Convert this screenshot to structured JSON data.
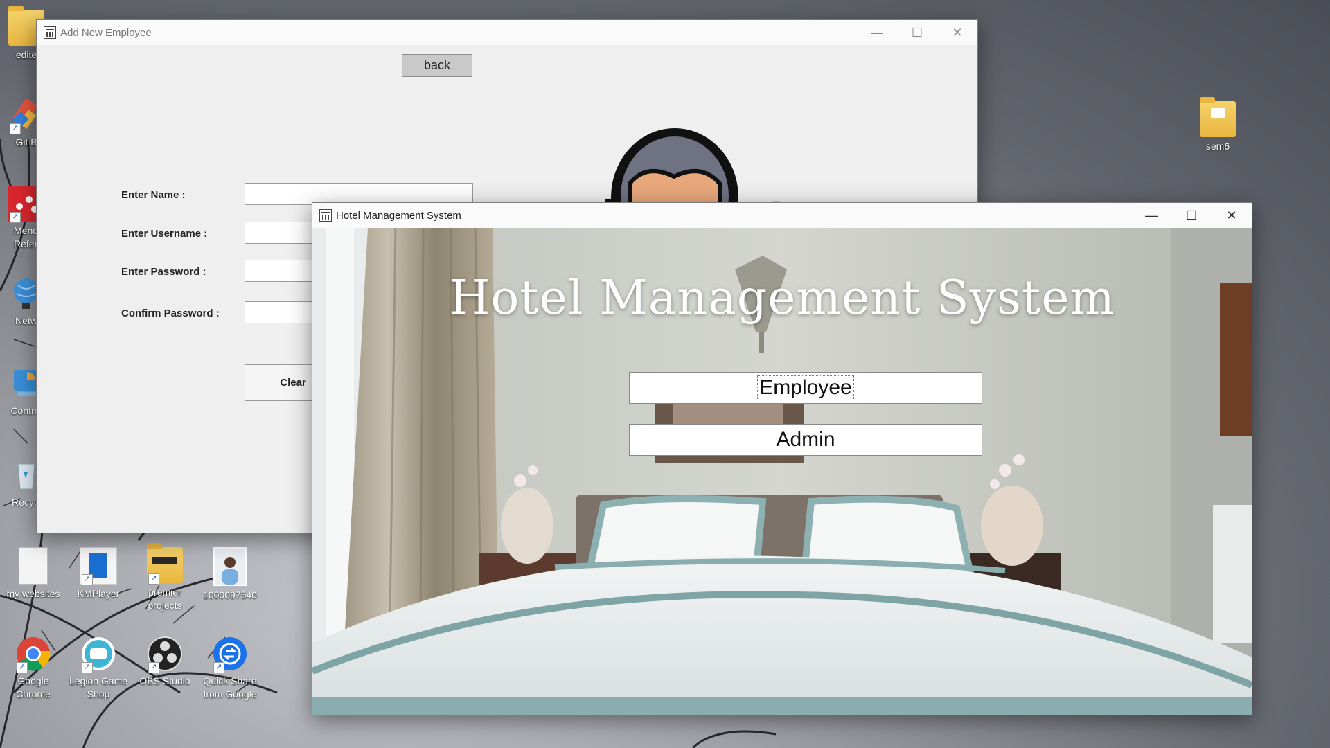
{
  "desktop": {
    "icons": [
      {
        "label": "edite",
        "icon": "folder-icon"
      },
      {
        "label": "Git B",
        "icon": "git-bash-icon"
      },
      {
        "label": "Mend Refer",
        "icon": "mendeley-icon"
      },
      {
        "label": "Netw",
        "icon": "network-icon"
      },
      {
        "label": "Control",
        "icon": "control-panel-icon"
      },
      {
        "label": "Recycl",
        "icon": "recycle-bin-icon"
      },
      {
        "label": "my websites",
        "icon": "file-icon"
      },
      {
        "label": "KMPlayer",
        "icon": "kmplayer-icon"
      },
      {
        "label": "premier projects",
        "icon": "folder-icon"
      },
      {
        "label": "1000097540",
        "icon": "photo-icon"
      },
      {
        "label": "Google Chrome",
        "icon": "chrome-icon"
      },
      {
        "label": "Legion Game Shop",
        "icon": "legion-icon"
      },
      {
        "label": "OBS Studio",
        "icon": "obs-icon"
      },
      {
        "label": "Quick Share from Google",
        "icon": "quick-share-icon"
      },
      {
        "label": "sem6",
        "icon": "folder-icon"
      }
    ]
  },
  "employee_window": {
    "title": "Add New Employee",
    "back_label": "back",
    "fields": [
      {
        "label": "Enter Name :",
        "value": ""
      },
      {
        "label": "Enter Username :",
        "value": ""
      },
      {
        "label": "Enter Password :",
        "value": ""
      },
      {
        "label": "Confirm Password :",
        "value": ""
      }
    ],
    "clear_label": "Clear"
  },
  "hotel_window": {
    "title": "Hotel Management System",
    "heading": "Hotel Management System",
    "employee_label": "Employee",
    "admin_label": "Admin"
  },
  "window_controls": {
    "minimize": "—",
    "maximize": "☐",
    "close": "✕"
  }
}
